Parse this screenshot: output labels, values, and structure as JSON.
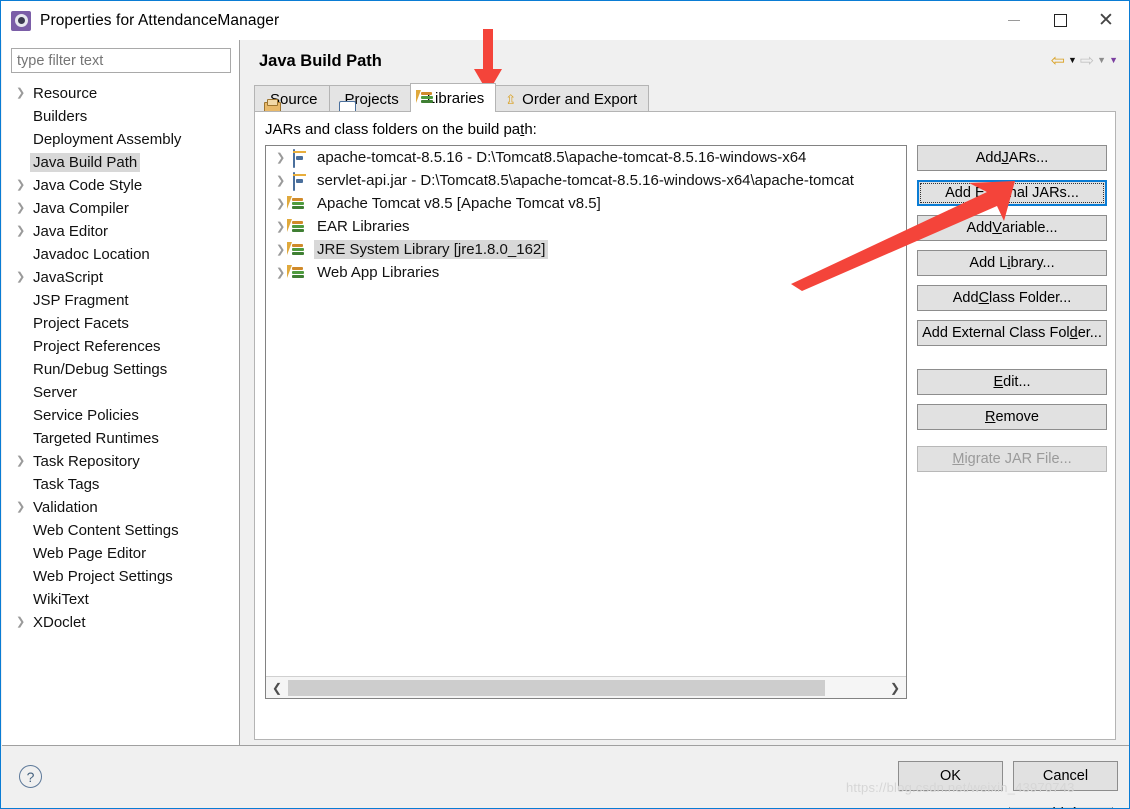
{
  "window": {
    "title": "Properties for AttendanceManager",
    "icon": "properties-gear-icon",
    "minimize_label": "—",
    "maximize_label": "□",
    "close_label": "✕"
  },
  "sidebar": {
    "filter": {
      "placeholder": "type filter text",
      "value": ""
    },
    "items": [
      {
        "label": "Resource",
        "expandable": true,
        "selected": false
      },
      {
        "label": "Builders",
        "expandable": false,
        "selected": false
      },
      {
        "label": "Deployment Assembly",
        "expandable": false,
        "selected": false
      },
      {
        "label": "Java Build Path",
        "expandable": false,
        "selected": true
      },
      {
        "label": "Java Code Style",
        "expandable": true,
        "selected": false
      },
      {
        "label": "Java Compiler",
        "expandable": true,
        "selected": false
      },
      {
        "label": "Java Editor",
        "expandable": true,
        "selected": false
      },
      {
        "label": "Javadoc Location",
        "expandable": false,
        "selected": false
      },
      {
        "label": "JavaScript",
        "expandable": true,
        "selected": false
      },
      {
        "label": "JSP Fragment",
        "expandable": false,
        "selected": false
      },
      {
        "label": "Project Facets",
        "expandable": false,
        "selected": false
      },
      {
        "label": "Project References",
        "expandable": false,
        "selected": false
      },
      {
        "label": "Run/Debug Settings",
        "expandable": false,
        "selected": false
      },
      {
        "label": "Server",
        "expandable": false,
        "selected": false
      },
      {
        "label": "Service Policies",
        "expandable": false,
        "selected": false
      },
      {
        "label": "Targeted Runtimes",
        "expandable": false,
        "selected": false
      },
      {
        "label": "Task Repository",
        "expandable": true,
        "selected": false
      },
      {
        "label": "Task Tags",
        "expandable": false,
        "selected": false
      },
      {
        "label": "Validation",
        "expandable": true,
        "selected": false
      },
      {
        "label": "Web Content Settings",
        "expandable": false,
        "selected": false
      },
      {
        "label": "Web Page Editor",
        "expandable": false,
        "selected": false
      },
      {
        "label": "Web Project Settings",
        "expandable": false,
        "selected": false
      },
      {
        "label": "WikiText",
        "expandable": false,
        "selected": false
      },
      {
        "label": "XDoclet",
        "expandable": true,
        "selected": false
      }
    ]
  },
  "page": {
    "title": "Java Build Path",
    "nav": {
      "back_icon": "back-arrow-icon",
      "back_menu_icon": "chevron-down-icon",
      "forward_icon": "forward-arrow-icon",
      "forward_menu_icon": "chevron-down-icon",
      "view_menu_icon": "chevron-down-icon"
    },
    "tabs": [
      {
        "label": "Source",
        "icon": "source-folder-icon",
        "active": false
      },
      {
        "label": "Projects",
        "icon": "open-folder-icon",
        "active": false
      },
      {
        "label": "Libraries",
        "icon": "library-books-icon",
        "active": true
      },
      {
        "label": "Order and Export",
        "icon": "order-export-icon",
        "active": false
      }
    ],
    "list_caption_pre": "JARs and class folders on the build pa",
    "list_caption_mn": "t",
    "list_caption_post": "h:",
    "libraries": [
      {
        "label": "apache-tomcat-8.5.16 - D:\\Tomcat8.5\\apache-tomcat-8.5.16-windows-x64",
        "icon": "jar-icon",
        "selected": false
      },
      {
        "label": "servlet-api.jar - D:\\Tomcat8.5\\apache-tomcat-8.5.16-windows-x64\\apache-tomcat",
        "icon": "jar-icon",
        "selected": false
      },
      {
        "label": "Apache Tomcat v8.5 [Apache Tomcat v8.5]",
        "icon": "library-books-icon",
        "selected": false
      },
      {
        "label": "EAR Libraries",
        "icon": "library-books-icon",
        "selected": false
      },
      {
        "label": "JRE System Library [jre1.8.0_162]",
        "icon": "library-books-icon",
        "selected": true
      },
      {
        "label": "Web App Libraries",
        "icon": "library-books-icon",
        "selected": false
      }
    ],
    "scrollbar": {
      "left_arrow_icon": "chevron-left-icon",
      "right_arrow_icon": "chevron-right-icon"
    },
    "buttons": [
      {
        "id": "add-jars",
        "pre": "Add ",
        "mn": "J",
        "post": "ARs...",
        "state": "normal"
      },
      {
        "id": "add-external-jars",
        "pre": "Add E",
        "mn": "x",
        "post": "ternal JARs...",
        "state": "focused"
      },
      {
        "id": "add-variable",
        "pre": "Add ",
        "mn": "V",
        "post": "ariable...",
        "state": "normal"
      },
      {
        "id": "add-library",
        "pre": "Add L",
        "mn": "i",
        "post": "brary...",
        "state": "normal"
      },
      {
        "id": "add-class-folder",
        "pre": "Add ",
        "mn": "C",
        "post": "lass Folder...",
        "state": "normal"
      },
      {
        "id": "add-external-class-folder",
        "pre": "Add External Class Fol",
        "mn": "d",
        "post": "er...",
        "state": "normal"
      },
      {
        "id": "edit",
        "pre": "",
        "mn": "E",
        "post": "dit...",
        "state": "normal"
      },
      {
        "id": "remove",
        "pre": "",
        "mn": "R",
        "post": "emove",
        "state": "normal"
      },
      {
        "id": "migrate-jar-file",
        "pre": "",
        "mn": "M",
        "post": "igrate JAR File...",
        "state": "disabled"
      }
    ],
    "apply": {
      "pre": "",
      "mn": "A",
      "post": "pply"
    }
  },
  "footer": {
    "help_icon": "help-question-icon",
    "ok_label": "OK",
    "cancel_label": "Cancel"
  },
  "annotations": {
    "down_arrow": "red-down-arrow-annotation",
    "diagonal_arrow": "red-diagonal-arrow-annotation",
    "color": "#f4443a"
  },
  "watermark": "https://blog.csdn.net/weixin_43970743"
}
